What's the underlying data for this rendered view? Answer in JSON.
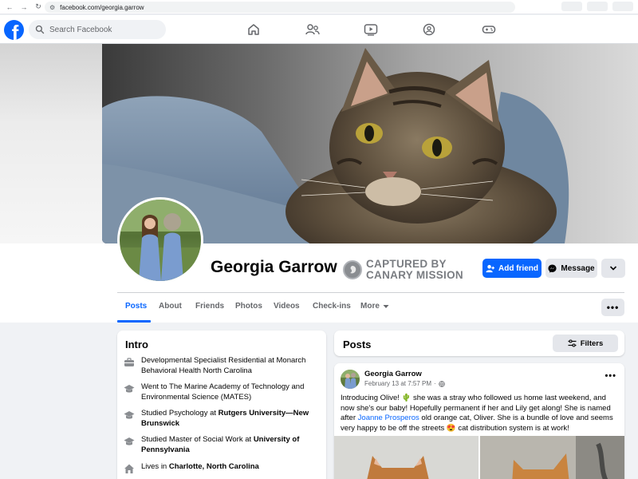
{
  "browser": {
    "url": "facebook.com/georgia.garrow"
  },
  "header": {
    "search_placeholder": "Search Facebook",
    "nav_icons": [
      "home-icon",
      "friends-icon",
      "video-icon",
      "groups-icon",
      "gaming-icon"
    ]
  },
  "profile": {
    "name": "Georgia Garrow",
    "watermark_line1": "CAPTURED BY",
    "watermark_line2": "CANARY MISSION",
    "add_friend_label": "Add friend",
    "message_label": "Message"
  },
  "tabs": [
    "Posts",
    "About",
    "Friends",
    "Photos",
    "Videos",
    "Check-ins",
    "More"
  ],
  "intro": {
    "title": "Intro",
    "items": [
      {
        "icon": "work-icon",
        "text": "Developmental Specialist Residential at Monarch Behavioral Health North Carolina",
        "bold": ""
      },
      {
        "icon": "education-icon",
        "text": "Went to The Marine Academy of Technology and Environmental Science (MATES)",
        "bold": ""
      },
      {
        "icon": "education-icon",
        "text": "Studied Psychology at ",
        "bold": "Rutgers University—New Brunswick"
      },
      {
        "icon": "education-icon",
        "text": "Studied Master of Social Work at ",
        "bold": "University of Pennsylvania"
      },
      {
        "icon": "home-icon",
        "text": "Lives in ",
        "bold": "Charlotte, North Carolina"
      }
    ]
  },
  "posts": {
    "title": "Posts",
    "filters_label": "Filters",
    "post": {
      "author": "Georgia Garrow",
      "date": "February 13 at 7:57 PM",
      "visibility": "·",
      "text_1": "Introducing Olive! 🌵 she was a stray who followed us home last weekend, and now she's our baby! Hopefully permanent if her and Lily get along! She is named after ",
      "mention": "Joanne Prosperos",
      "text_2": " old orange cat, Oliver. She is a bundle of love and seems very happy to be off the streets 😍 cat distribution system is at work!"
    }
  },
  "colors": {
    "brand": "#0866ff",
    "background": "#f0f2f5",
    "secondary_button": "#e4e6eb"
  }
}
